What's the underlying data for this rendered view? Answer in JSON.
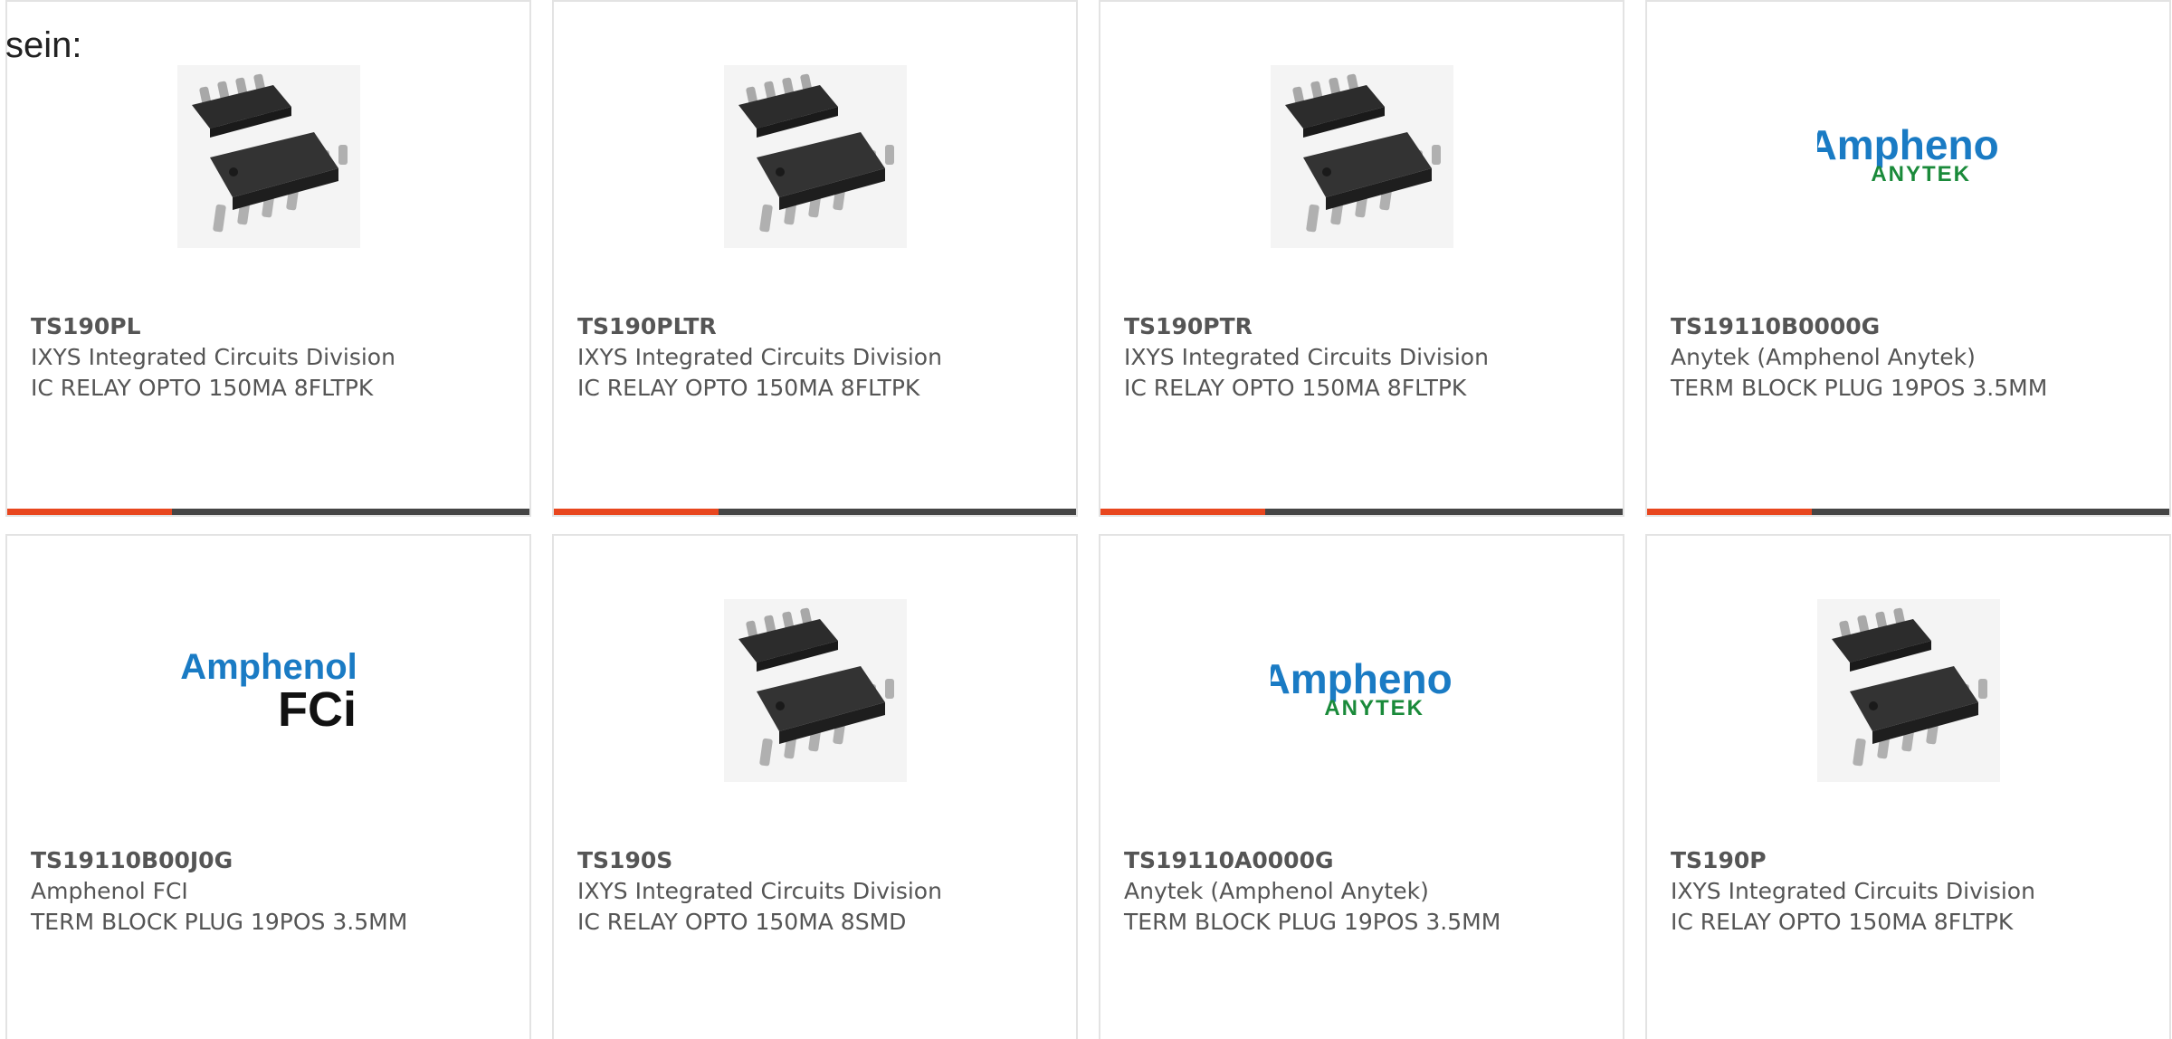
{
  "intro_text": "sein:",
  "accent_color": "#e8461e",
  "bar_color": "#454545",
  "products": [
    {
      "part_number": "TS190PL",
      "manufacturer": "IXYS Integrated Circuits Division",
      "description": "IC RELAY OPTO 150MA 8FLTPK",
      "image": "chip-icon"
    },
    {
      "part_number": "TS190PLTR",
      "manufacturer": "IXYS Integrated Circuits Division",
      "description": "IC RELAY OPTO 150MA 8FLTPK",
      "image": "chip-icon"
    },
    {
      "part_number": "TS190PTR",
      "manufacturer": "IXYS Integrated Circuits Division",
      "description": "IC RELAY OPTO 150MA 8FLTPK",
      "image": "chip-icon"
    },
    {
      "part_number": "TS19110B0000G",
      "manufacturer": "Anytek (Amphenol Anytek)",
      "description": "TERM BLOCK PLUG 19POS 3.5MM",
      "image": "amphenol-anytek-logo",
      "logo_text": "Amphenol",
      "logo_subtext": "ANYTEK"
    },
    {
      "part_number": "TS19110B00J0G",
      "manufacturer": "Amphenol FCI",
      "description": "TERM BLOCK PLUG 19POS 3.5MM",
      "image": "amphenol-fci-logo",
      "logo_text": "Amphenol",
      "logo_subtext": "FCi"
    },
    {
      "part_number": "TS190S",
      "manufacturer": "IXYS Integrated Circuits Division",
      "description": "IC RELAY OPTO 150MA 8SMD",
      "image": "chip-icon"
    },
    {
      "part_number": "TS19110A0000G",
      "manufacturer": "Anytek (Amphenol Anytek)",
      "description": "TERM BLOCK PLUG 19POS 3.5MM",
      "image": "amphenol-anytek-logo",
      "logo_text": "Amphenol",
      "logo_subtext": "ANYTEK"
    },
    {
      "part_number": "TS190P",
      "manufacturer": "IXYS Integrated Circuits Division",
      "description": "IC RELAY OPTO 150MA 8FLTPK",
      "image": "chip-icon"
    }
  ]
}
